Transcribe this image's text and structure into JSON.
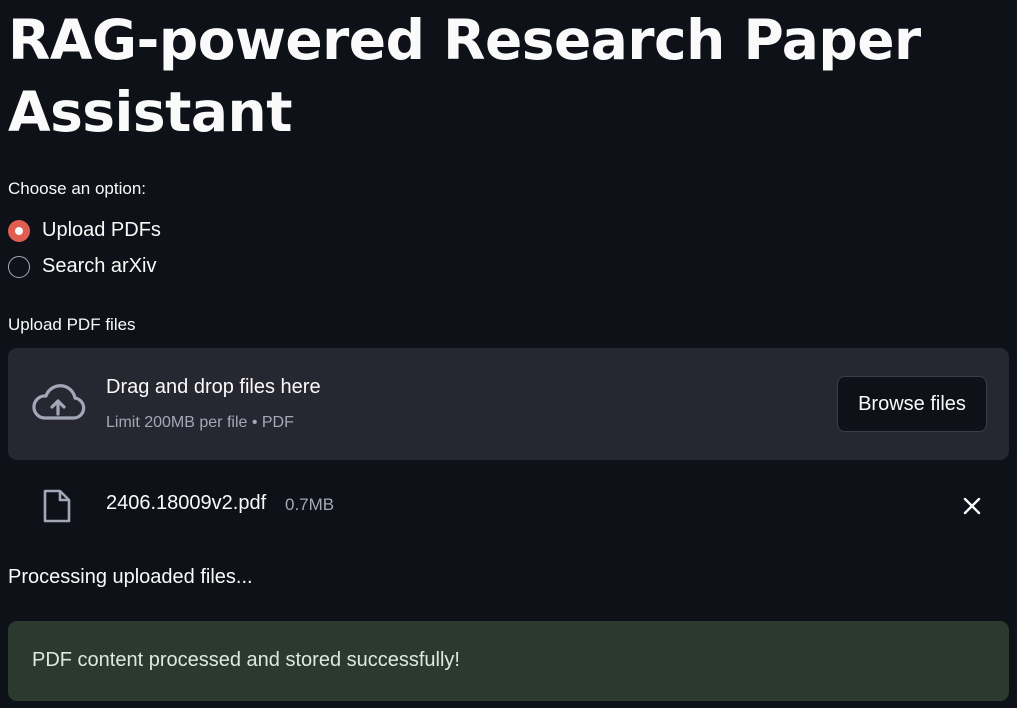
{
  "page": {
    "title": "RAG-powered Research Paper Assistant"
  },
  "options": {
    "label": "Choose an option:",
    "items": [
      {
        "label": "Upload PDFs",
        "selected": true
      },
      {
        "label": "Search arXiv",
        "selected": false
      }
    ]
  },
  "uploader": {
    "label": "Upload PDF files",
    "drop_text": "Drag and drop files here",
    "limit_text": "Limit 200MB per file • PDF",
    "browse_label": "Browse files",
    "icon": "cloud-upload-icon"
  },
  "files": [
    {
      "name": "2406.18009v2.pdf",
      "size": "0.7MB",
      "icon": "file-icon"
    }
  ],
  "status": {
    "processing": "Processing uploaded files...",
    "success": "PDF content processed and stored successfully!"
  },
  "colors": {
    "background": "#0e1117",
    "accent": "#e05d50",
    "dropzone": "#262730",
    "success_bg": "#2b3a2f"
  }
}
